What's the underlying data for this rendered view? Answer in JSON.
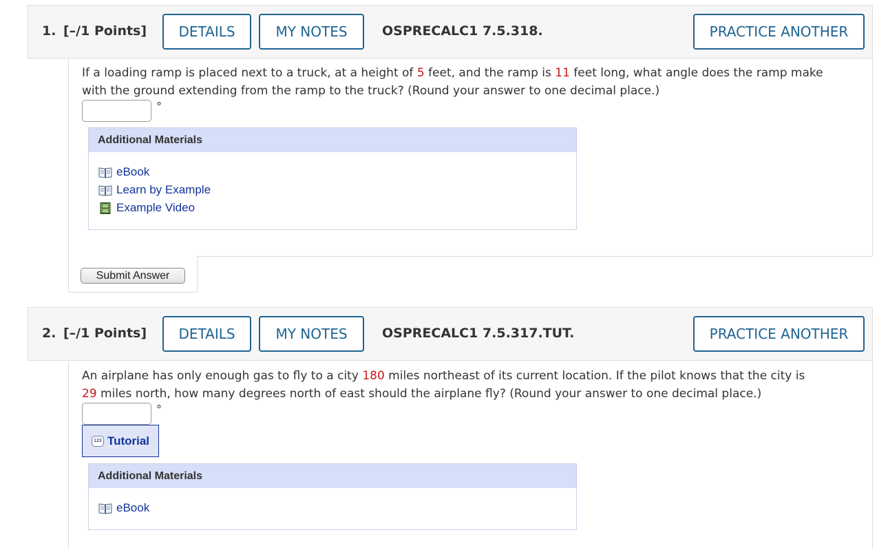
{
  "q1": {
    "number": "1.",
    "points": "[–/1 Points]",
    "details_label": "DETAILS",
    "notes_label": "MY NOTES",
    "id": "OSPRECALC1 7.5.318.",
    "practice_label": "PRACTICE ANOTHER",
    "text": {
      "p1": "If a loading ramp is placed next to a truck, at a height of ",
      "v1": "5",
      "p2": " feet, and the ramp is ",
      "v2": "11",
      "p3": " feet long, what angle does the ramp make",
      "p4": "with the ground extending from the ramp to the truck? (Round your answer to one decimal place.)"
    },
    "unit": "°",
    "materials": {
      "heading": "Additional Materials",
      "items": [
        {
          "label": "eBook",
          "icon": "book-icon"
        },
        {
          "label": "Learn by Example",
          "icon": "book-icon"
        },
        {
          "label": "Example Video",
          "icon": "film-icon"
        }
      ]
    },
    "submit_label": "Submit Answer"
  },
  "q2": {
    "number": "2.",
    "points": "[–/1 Points]",
    "details_label": "DETAILS",
    "notes_label": "MY NOTES",
    "id": "OSPRECALC1 7.5.317.TUT.",
    "practice_label": "PRACTICE ANOTHER",
    "text": {
      "p1": "An airplane has only enough gas to fly to a city ",
      "v1": "180",
      "p2": " miles northeast of its current location. If the pilot knows that the city is",
      "v2": "29",
      "p3": " miles north, how many degrees north of east should the airplane fly? (Round your answer to one decimal place.)"
    },
    "unit": "°",
    "tutorial_label": "Tutorial",
    "tutorial_icon_text": "123",
    "materials": {
      "heading": "Additional Materials",
      "items": [
        {
          "label": "eBook",
          "icon": "book-icon"
        }
      ]
    }
  },
  "colors": {
    "accent": "#1f6391",
    "link": "#13339c",
    "value_red": "#c8171e",
    "materials_header": "#d7def7"
  }
}
